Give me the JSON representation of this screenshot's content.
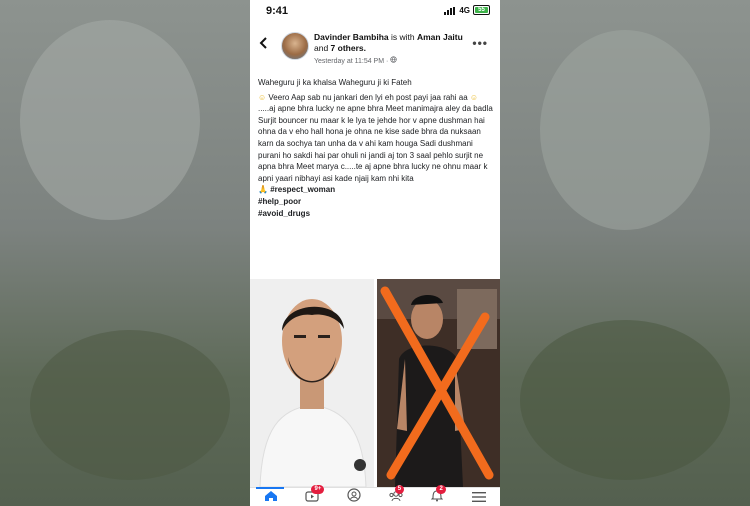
{
  "status_bar": {
    "time": "9:41",
    "network": "4G",
    "battery": "55"
  },
  "post": {
    "author_name": "Davinder Bambiha",
    "with_text": " is with ",
    "tagged_name": "Aman Jaitu",
    "and_text": " and ",
    "others": "7 others.",
    "timestamp": "Yesterday at 11:54 PM",
    "privacy_icon": "globe-icon",
    "line1": "Waheguru ji ka khalsa Waheguru ji ki Fateh",
    "line2": "Veero Aap sab nu jankari den lyi eh post payi jaa rahi aa",
    "paragraph": ".....aj apne bhra lucky ne apne bhra Meet manimajra aley da badla Surjit bouncer nu maar k le lya te jehde hor v apne dushman hai ohna da v eho hall hona je ohna ne kise sade bhra da nuksaan karn da sochya tan unha da v ahi kam houga Sadi dushmani purani ho sakdi hai par ohuli ni jandi aj ton 3 saal pehlo surjit ne apna bhra Meet marya c.....te aj apne bhra lucky ne ohnu maar k apni yaari nibhayi asi kade njaij kam nhi kita",
    "hashtags": [
      "#respect_woman",
      "#help_poor",
      "#avoid_drugs"
    ]
  },
  "tabbar": {
    "tabs": [
      {
        "name": "home",
        "badge": ""
      },
      {
        "name": "watch",
        "badge": "9+"
      },
      {
        "name": "profile",
        "badge": ""
      },
      {
        "name": "groups",
        "badge": "5"
      },
      {
        "name": "notifications",
        "badge": "2"
      },
      {
        "name": "menu",
        "badge": ""
      }
    ]
  },
  "colors": {
    "accent": "#1877f2",
    "badge": "#e41e3f",
    "cross": "#f26b1d"
  }
}
